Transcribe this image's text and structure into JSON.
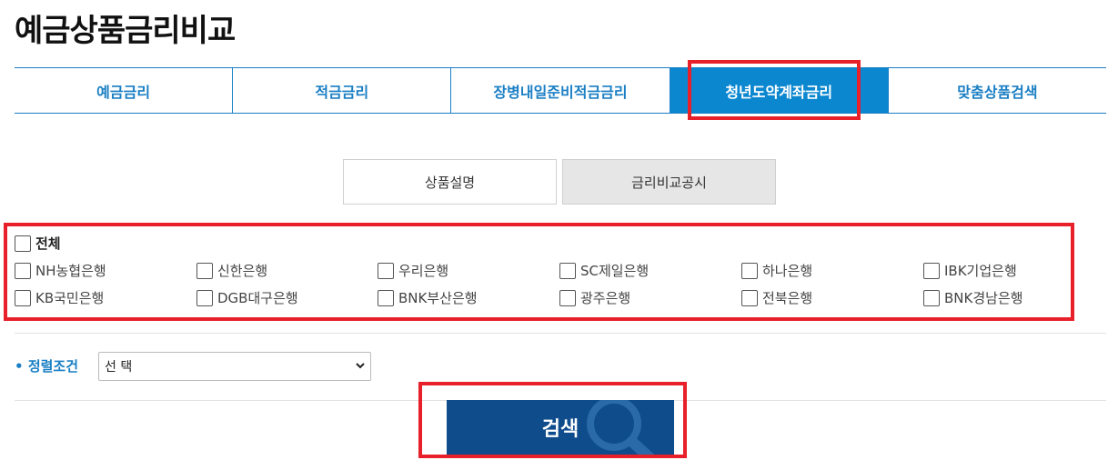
{
  "page_title": "예금상품금리비교",
  "main_tabs": [
    {
      "label": "예금금리",
      "active": false
    },
    {
      "label": "적금금리",
      "active": false
    },
    {
      "label": "장병내일준비적금금리",
      "active": false
    },
    {
      "label": "청년도약계좌금리",
      "active": true
    },
    {
      "label": "맞춤상품검색",
      "active": false
    }
  ],
  "sub_tabs": [
    {
      "label": "상품설명",
      "active": false
    },
    {
      "label": "금리비교공시",
      "active": true
    }
  ],
  "banks": {
    "all_label": "전체",
    "items": [
      "NH농협은행",
      "신한은행",
      "우리은행",
      "SC제일은행",
      "하나은행",
      "IBK기업은행",
      "KB국민은행",
      "DGB대구은행",
      "BNK부산은행",
      "광주은행",
      "전북은행",
      "BNK경남은행"
    ]
  },
  "sort": {
    "label": "정렬조건",
    "selected": "선 택"
  },
  "search_button": {
    "label": "검색"
  },
  "colors": {
    "accent": "#1a7fc4",
    "active_tab": "#0b87d0",
    "search_button": "#0e4c8c",
    "highlight": "#e8202a"
  }
}
